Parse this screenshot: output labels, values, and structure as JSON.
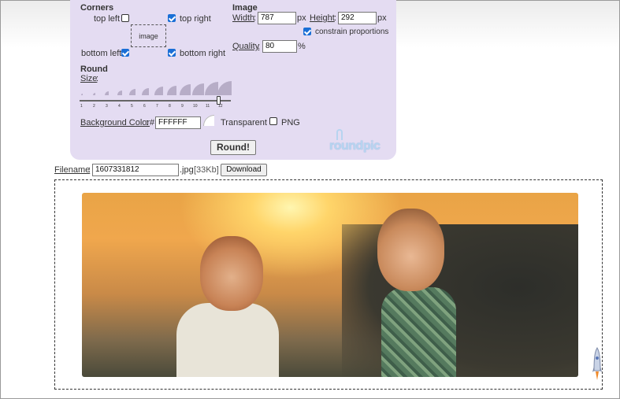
{
  "corners": {
    "title": "Corners",
    "top_left": {
      "label": "top left",
      "checked": false
    },
    "top_right": {
      "label": "top right",
      "checked": true
    },
    "bottom_left": {
      "label": "bottom left",
      "checked": true
    },
    "bottom_right": {
      "label": "bottom right",
      "checked": true
    },
    "preview_label": "image"
  },
  "image": {
    "title": "Image",
    "width_label": "Width",
    "width_value": "787",
    "width_unit": "px",
    "height_label": "Height",
    "height_value": "292",
    "height_unit": "px",
    "constrain_label": "constrain proportions",
    "constrain_checked": true,
    "quality_label": "Quality",
    "quality_value": "80",
    "quality_unit": "%"
  },
  "round": {
    "title": "Round",
    "size_label": "Size",
    "size_ticks": [
      "1",
      "2",
      "3",
      "4",
      "5",
      "6",
      "7",
      "8",
      "9",
      "10",
      "11",
      "12"
    ],
    "size_selected": 12
  },
  "background": {
    "label": "Background Color",
    "hash": "#",
    "value": "FFFFFF",
    "transparent_label": "Transparent",
    "png_label": "PNG",
    "png_checked": false
  },
  "round_button": "Round!",
  "logo_text": "roundpic",
  "output": {
    "filename_label": "Filename",
    "filename_value": "1607331812",
    "extension": ".jpg",
    "size_text": "[33Kb]",
    "download_label": "Download"
  },
  "colors": {
    "panel": "#e4dcf2",
    "accent": "#1a6fd6",
    "logo": "#b7d4f0"
  }
}
